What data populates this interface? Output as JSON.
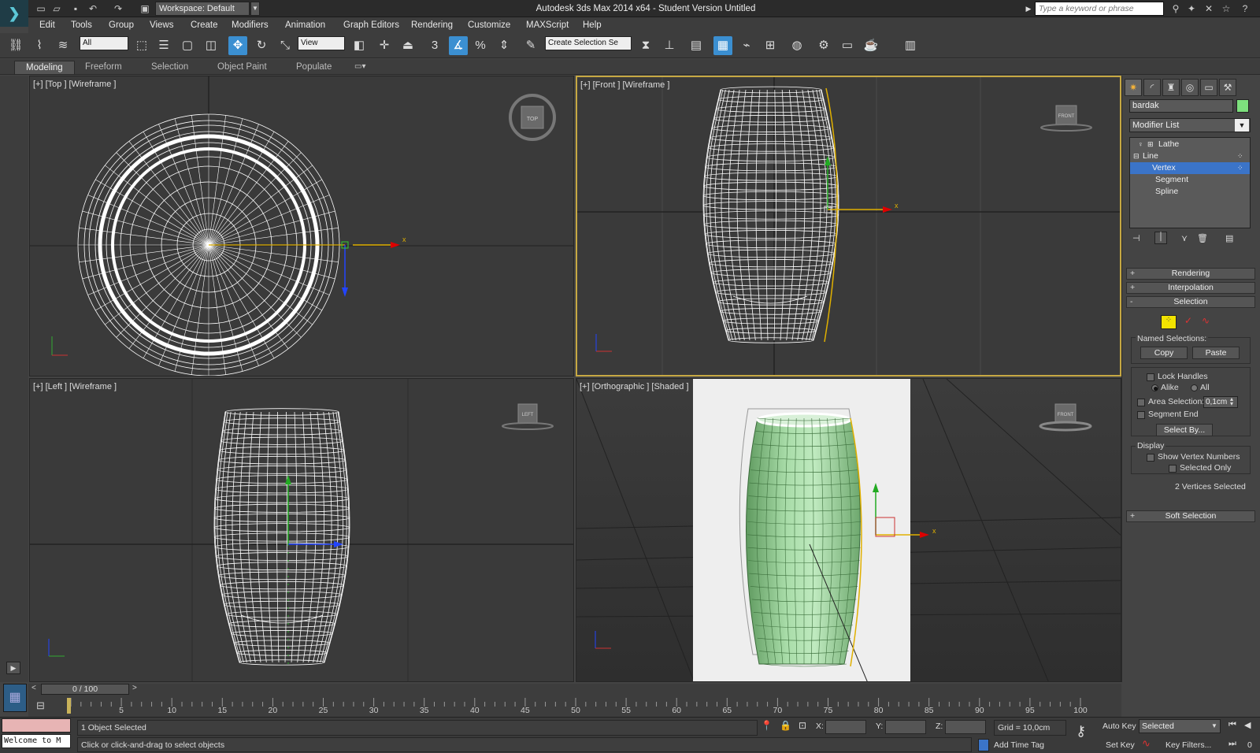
{
  "titlebar": {
    "workspace": "Workspace: Default",
    "title": "Autodesk 3ds Max  2014 x64   - Student Version    Untitled",
    "search_placeholder": "Type a keyword or phrase"
  },
  "menu": [
    "Edit",
    "Tools",
    "Group",
    "Views",
    "Create",
    "Modifiers",
    "Animation",
    "Graph Editors",
    "Rendering",
    "Customize",
    "MAXScript",
    "Help"
  ],
  "toolbar": {
    "selection_filter": "All",
    "ref_coord": "View",
    "named_selection": "Create Selection Se",
    "snap_label": "3"
  },
  "ribbon_tabs": [
    "Modeling",
    "Freeform",
    "Selection",
    "Object Paint",
    "Populate"
  ],
  "viewports": {
    "top": "[+] [Top ] [Wireframe ]",
    "front": "[+] [Front ] [Wireframe ]",
    "left": "[+] [Left ] [Wireframe ]",
    "ortho": "[+] [Orthographic ] [Shaded ]",
    "viewcube_top": "TOP",
    "viewcube_front": "FRONT",
    "viewcube_left": "LEFT"
  },
  "command_panel": {
    "object_name": "bardak",
    "object_color": "#7de07d",
    "modifier_list": "Modifier List",
    "stack": [
      "Lathe",
      "Line",
      "Vertex",
      "Segment",
      "Spline"
    ],
    "rollouts": {
      "rendering": "Rendering",
      "interpolation": "Interpolation",
      "selection": "Selection",
      "soft_selection": "Soft Selection"
    },
    "named_selections": "Named Selections:",
    "copy": "Copy",
    "paste": "Paste",
    "lock_handles": "Lock Handles",
    "alike": "Alike",
    "all": "All",
    "area_selection": "Area Selection:",
    "area_value": "0,1cm",
    "segment_end": "Segment End",
    "select_by": "Select By...",
    "display": "Display",
    "show_vertex_numbers": "Show Vertex Numbers",
    "selected_only": "Selected Only",
    "vertices_selected": "2 Vertices Selected"
  },
  "timeline": {
    "slider": "0 / 100",
    "ticks": [
      5,
      10,
      15,
      20,
      25,
      30,
      35,
      40,
      45,
      50,
      55,
      60,
      65,
      70,
      75,
      80,
      85,
      90,
      95,
      100
    ]
  },
  "status": {
    "welcome": "Welcome to M",
    "objects_selected": "1 Object Selected",
    "prompt": "Click or click-and-drag to select objects",
    "x_label": "X:",
    "y_label": "Y:",
    "z_label": "Z:",
    "grid": "Grid = 10,0cm",
    "add_time_tag": "Add Time Tag",
    "auto_key": "Auto Key",
    "set_key": "Set Key",
    "selected_dropdown": "Selected",
    "key_filters": "Key Filters...",
    "frame": "0"
  }
}
